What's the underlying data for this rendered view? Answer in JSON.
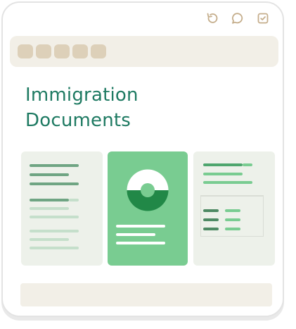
{
  "document": {
    "title_line1": "Immigration",
    "title_line2": "Documents"
  },
  "toolbar": {
    "icons": [
      "undo-icon",
      "comment-icon",
      "task-check-icon"
    ]
  },
  "dot_bar": {
    "dot_count": 5
  },
  "colors": {
    "accent_green": "#1e7a62",
    "card_green": "#79cc91",
    "light_card": "#edf1ea",
    "beige_bar": "#f2efe7",
    "beige_dot": "#ddd0b9",
    "toolbar_icon": "#c5ae8c"
  }
}
